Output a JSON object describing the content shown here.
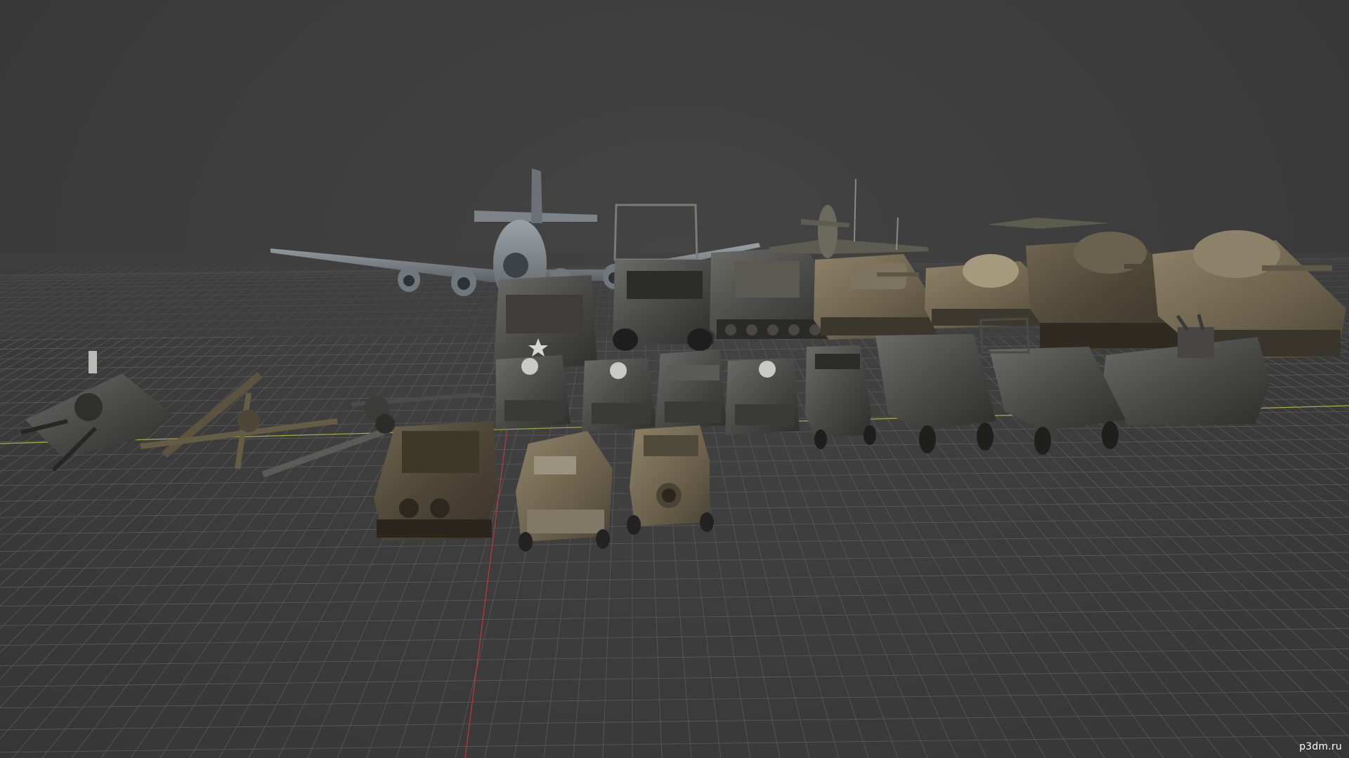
{
  "viewport": {
    "background": "#3d3d3d",
    "grid_color": "#5a5a5a",
    "x_axis_color": "#a8b23a",
    "y_axis_color": "#c0393b"
  },
  "scene": {
    "objects": [
      {
        "name": "bomber-aircraft",
        "icon": "airplane-icon"
      },
      {
        "name": "cargo-truck",
        "icon": "truck-icon"
      },
      {
        "name": "fighter-aircraft",
        "icon": "airplane-icon"
      },
      {
        "name": "tiger-tank",
        "icon": "tank-icon"
      },
      {
        "name": "sherman-tank",
        "icon": "tank-icon"
      },
      {
        "name": "light-tank",
        "icon": "tank-icon"
      },
      {
        "name": "flak-gun",
        "icon": "cannon-icon"
      },
      {
        "name": "field-gun",
        "icon": "cannon-icon"
      },
      {
        "name": "jeep",
        "icon": "car-icon"
      },
      {
        "name": "half-track",
        "icon": "truck-icon"
      },
      {
        "name": "armored-car",
        "icon": "car-icon"
      },
      {
        "name": "bren-carrier",
        "icon": "tank-icon"
      }
    ]
  },
  "watermark": "p3dm.ru"
}
